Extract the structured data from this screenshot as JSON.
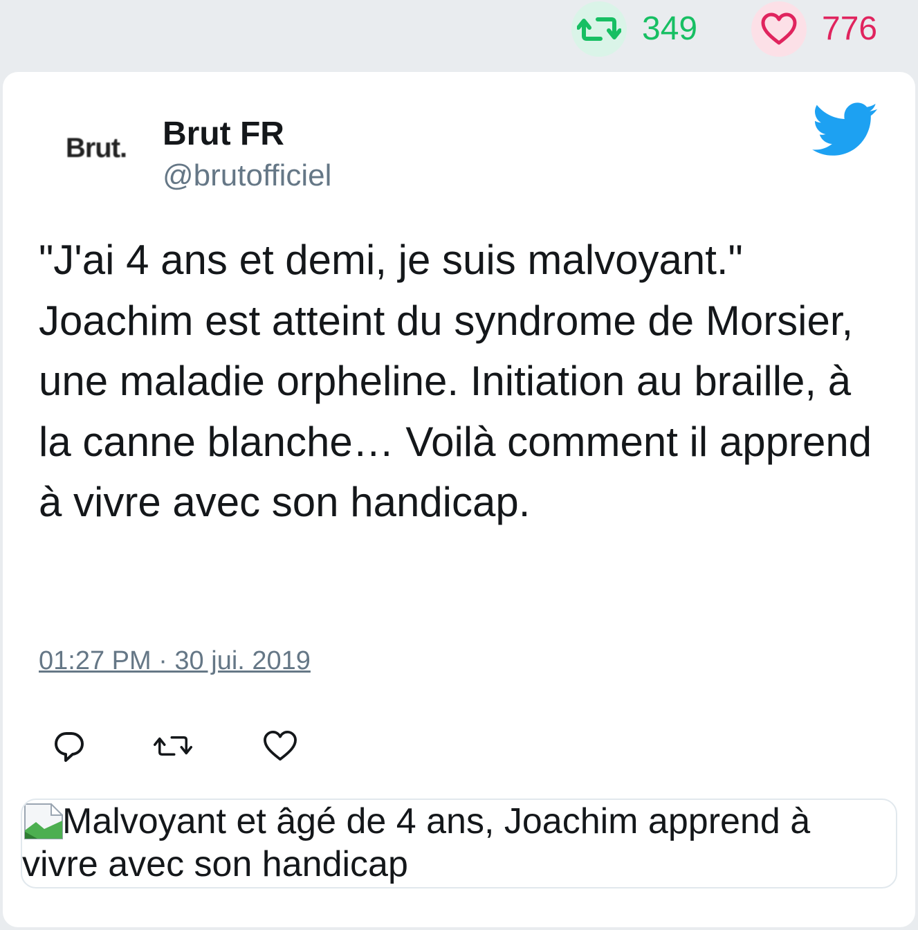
{
  "stats": {
    "retweets": "349",
    "likes": "776",
    "retweet_icon": "retweet-icon",
    "like_icon": "heart-icon"
  },
  "tweet": {
    "avatar_text": "Brut.",
    "name": "Brut FR",
    "handle": "@brutofficiel",
    "text": "\"J'ai 4 ans et demi, je suis malvoyant.\" Joachim est atteint du syndrome de Morsier, une maladie orpheline. Initiation au braille, à la canne blanche… Voilà comment il apprend à vivre avec son handicap.",
    "timestamp": "01:27 PM · 30 jui. 2019"
  },
  "actions": [
    "reply-icon",
    "retweet-icon",
    "heart-icon"
  ],
  "link_card": {
    "alt_text": "Malvoyant et âgé de 4 ans, Joachim apprend à vivre avec son handicap"
  },
  "colors": {
    "retweet": "#17bf63",
    "like": "#e0245e",
    "twitter_blue": "#1da1f2",
    "muted": "#657786"
  }
}
